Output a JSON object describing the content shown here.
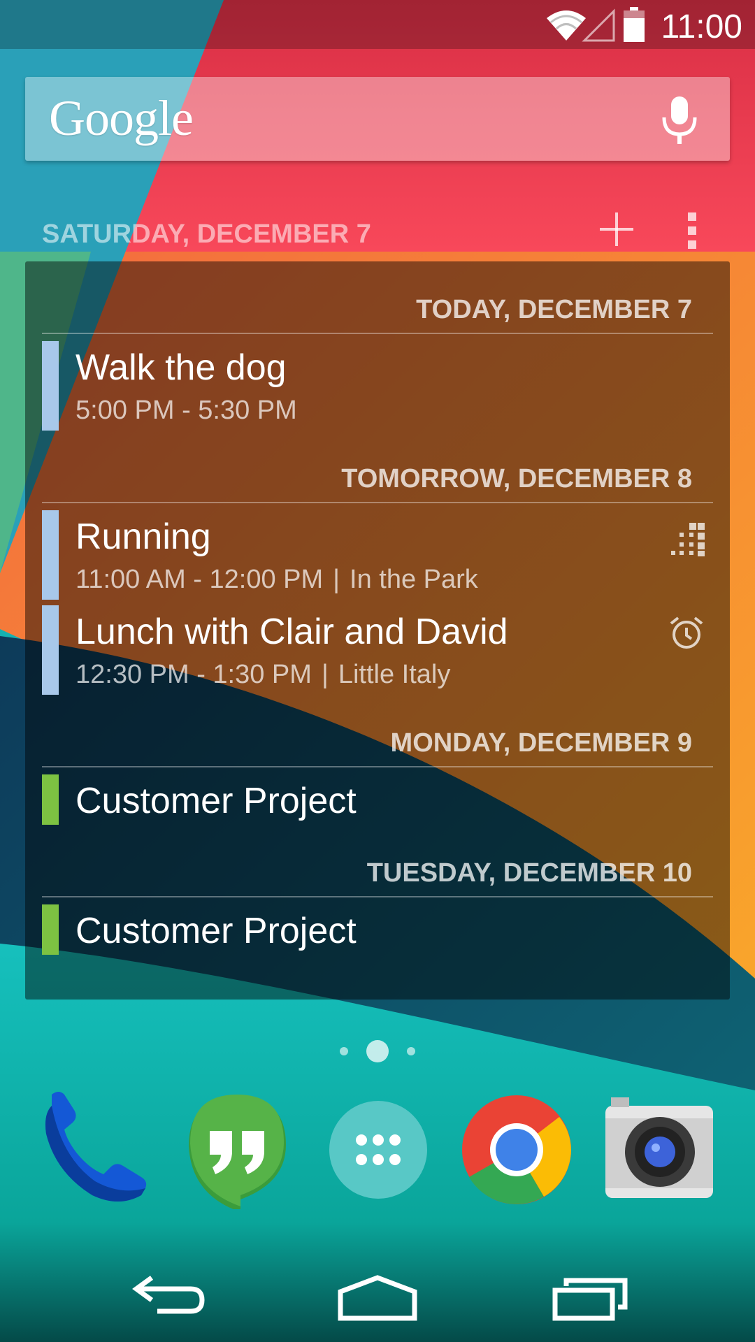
{
  "status_bar": {
    "time": "11:00",
    "icons": [
      "wifi-icon",
      "signal-icon",
      "battery-icon"
    ]
  },
  "search": {
    "logo_text": "Google",
    "voice_icon": "mic-icon"
  },
  "calendar": {
    "header_date": "SATURDAY, DECEMBER 7",
    "header_actions": [
      "add-event-icon",
      "overflow-menu-icon"
    ],
    "days": [
      {
        "label": "TODAY, DECEMBER 7",
        "events": [
          {
            "title": "Walk the dog",
            "time": "5:00 PM - 5:30 PM",
            "location": "",
            "color": "#a8c8ea",
            "icon": ""
          }
        ]
      },
      {
        "label": "TOMORROW, DECEMBER 8",
        "events": [
          {
            "title": "Running",
            "time": "11:00 AM - 12:00 PM",
            "location": "In the Park",
            "color": "#a8c8ea",
            "icon": "recurring-icon"
          },
          {
            "title": "Lunch with Clair and David",
            "time": "12:30 PM - 1:30 PM",
            "location": "Little Italy",
            "color": "#a8c8ea",
            "icon": "alarm-icon"
          }
        ]
      },
      {
        "label": "MONDAY, DECEMBER 9",
        "events": [
          {
            "title": "Customer Project",
            "time": "",
            "location": "",
            "color": "#7dc242",
            "icon": ""
          }
        ]
      },
      {
        "label": "TUESDAY, DECEMBER 10",
        "events": [
          {
            "title": "Customer Project",
            "time": "",
            "location": "",
            "color": "#7dc242",
            "icon": ""
          }
        ]
      }
    ],
    "separator": "|"
  },
  "dock": {
    "apps": [
      "phone-icon",
      "hangouts-icon",
      "app-drawer-icon",
      "chrome-icon",
      "camera-icon"
    ]
  },
  "home_pages": {
    "count": 3,
    "current": 2
  },
  "nav_bar": {
    "buttons": [
      "back-icon",
      "home-icon",
      "recents-icon"
    ]
  },
  "colors": {
    "wallpaper_teal": "#12a7a6",
    "wallpaper_red": "#f0414f",
    "wallpaper_orange": "#f7843c",
    "wallpaper_navy": "#0d3a55",
    "event_blue": "#a8c8ea",
    "event_green": "#7dc242"
  }
}
